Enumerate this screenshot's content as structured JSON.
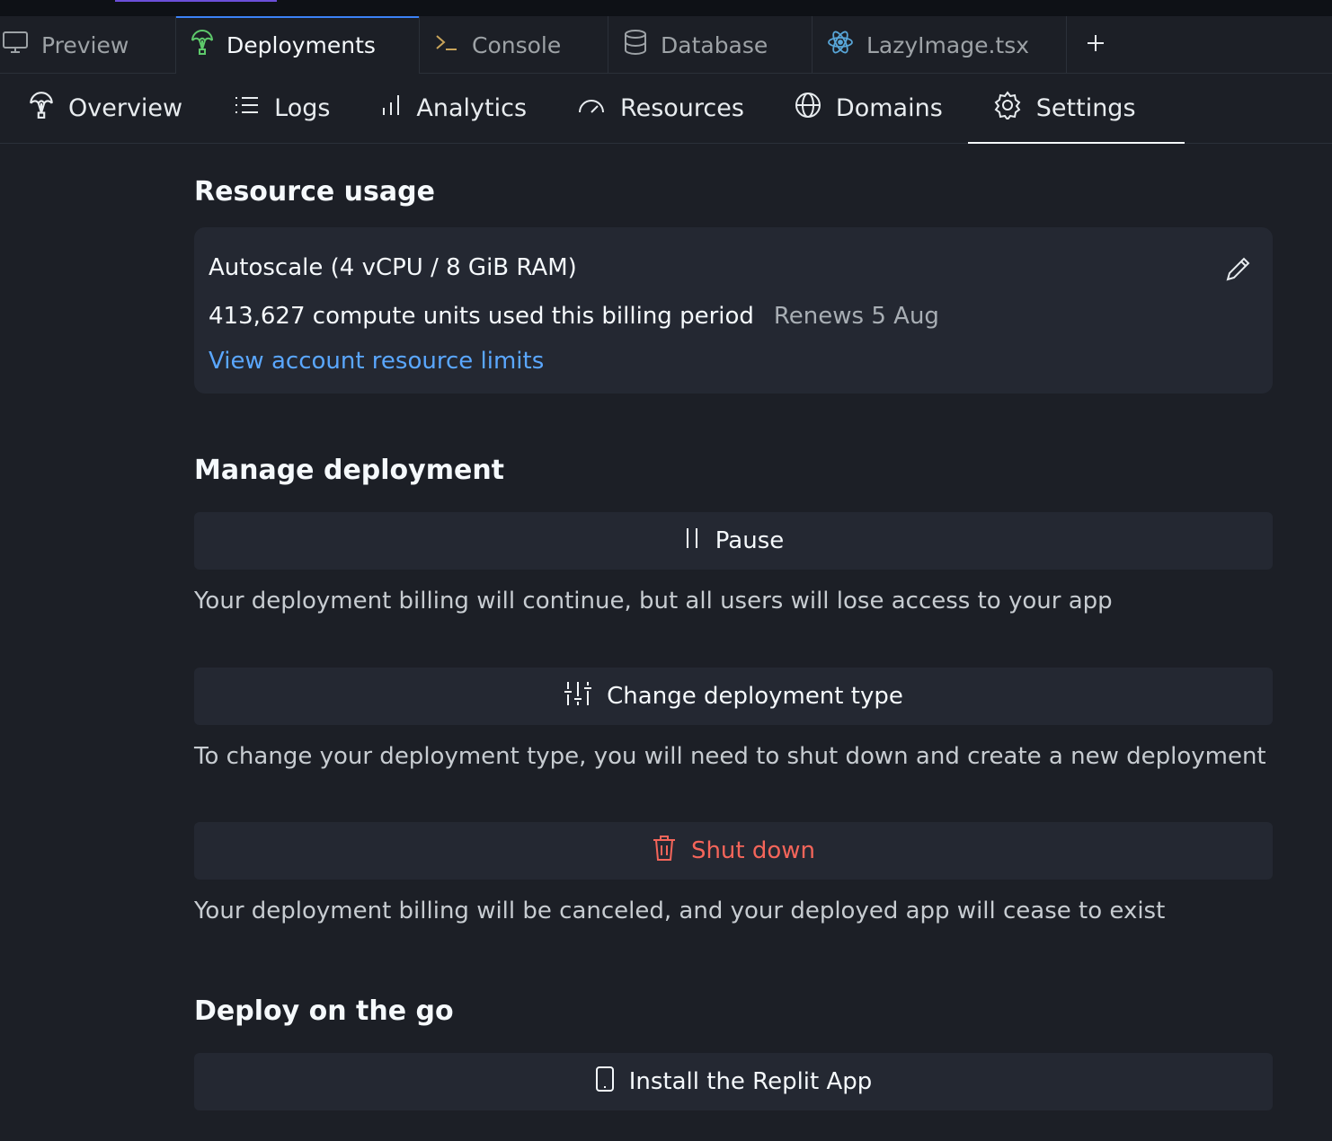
{
  "file_tabs": [
    {
      "label": "Preview",
      "icon": "monitor-icon"
    },
    {
      "label": "Deployments",
      "icon": "deployments-icon"
    },
    {
      "label": "Console",
      "icon": "terminal-icon"
    },
    {
      "label": "Database",
      "icon": "database-icon"
    },
    {
      "label": "LazyImage.tsx",
      "icon": "react-icon"
    }
  ],
  "sub_nav": [
    {
      "label": "Overview",
      "icon": "deployments-icon"
    },
    {
      "label": "Logs",
      "icon": "list-icon"
    },
    {
      "label": "Analytics",
      "icon": "bar-chart-icon"
    },
    {
      "label": "Resources",
      "icon": "gauge-icon"
    },
    {
      "label": "Domains",
      "icon": "globe-icon"
    },
    {
      "label": "Settings",
      "icon": "gear-icon"
    }
  ],
  "resource_usage": {
    "title": "Resource usage",
    "plan": "Autoscale (4 vCPU / 8 GiB RAM)",
    "usage": "413,627 compute units used this billing period",
    "renews": "Renews 5 Aug",
    "link": "View account resource limits"
  },
  "manage": {
    "title": "Manage deployment",
    "pause_label": "Pause",
    "pause_desc": "Your deployment billing will continue, but all users will lose access to your app",
    "change_label": "Change deployment type",
    "change_desc": "To change your deployment type, you will need to shut down and create a new deployment",
    "shutdown_label": "Shut down",
    "shutdown_desc": "Your deployment billing will be canceled, and your deployed app will cease to exist"
  },
  "mobile": {
    "title": "Deploy on the go",
    "install_label": "Install the Replit App"
  },
  "colors": {
    "background": "#1c1f26",
    "card": "#242832",
    "link": "#5aa7ff",
    "danger": "#f4655a",
    "active_tab": "#3b82f6"
  }
}
